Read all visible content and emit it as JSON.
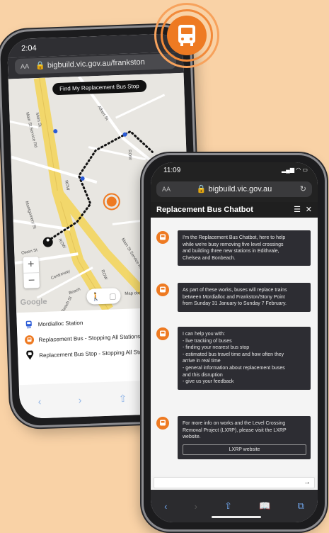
{
  "phone1": {
    "time": "2:04",
    "url": "bigbuild.vic.gov.au/frankston",
    "text_size_label": "AA",
    "find_stop_label": "Find My Replacement Bus Stop",
    "streets": [
      "Main St",
      "Main St Service Rd",
      "Albert St",
      "ROW",
      "ROW",
      "Montgomery St",
      "Owen St",
      "ROW",
      "Centreway",
      "Beach St",
      "Beach",
      "Main St Service Rd",
      "ROW"
    ],
    "map_data_label": "Map data",
    "google_label": "Google",
    "legend": [
      {
        "icon": "train-icon",
        "label": "Mordialloc Station"
      },
      {
        "icon": "bus-icon",
        "label": "Replacement Bus - Stopping All Stations (S"
      },
      {
        "icon": "bus-stop-pin-icon",
        "label": "Replacement Bus Stop - Stopping All Stati"
      }
    ]
  },
  "phone2": {
    "time": "11:09",
    "url": "bigbuild.vic.gov.au",
    "text_size_label": "AA",
    "chat_title": "Replacement Bus Chatbot",
    "messages": [
      {
        "lines": [
          "I'm the Replacement Bus Chatbot, here to help",
          "while we're busy removing five level crossings",
          "and building three new stations in Edithvale,",
          "Chelsea and Bonbeach."
        ]
      },
      {
        "lines": [
          "As part of these works, buses will replace trains",
          "between Mordialloc and Frankston/Stony Point",
          "from Sunday 31 January to Sunday 7 February."
        ]
      },
      {
        "lines": [
          "I can help you with:",
          "- live tracking of buses",
          "- finding your nearest bus stop",
          "- estimated bus travel time and how often they",
          "arrive in real time",
          "- general information about replacement buses",
          "and this disruption",
          "- give us your feedback"
        ]
      },
      {
        "lines": [
          "For more info on works and the Level Crossing",
          "Removal Project (LXRP), please visit the LXRP",
          "website."
        ],
        "button": "LXRP website"
      }
    ]
  },
  "colors": {
    "background": "#f9d2a6",
    "accent_orange": "#ee7a22",
    "chat_bubble": "#2d2d33"
  }
}
